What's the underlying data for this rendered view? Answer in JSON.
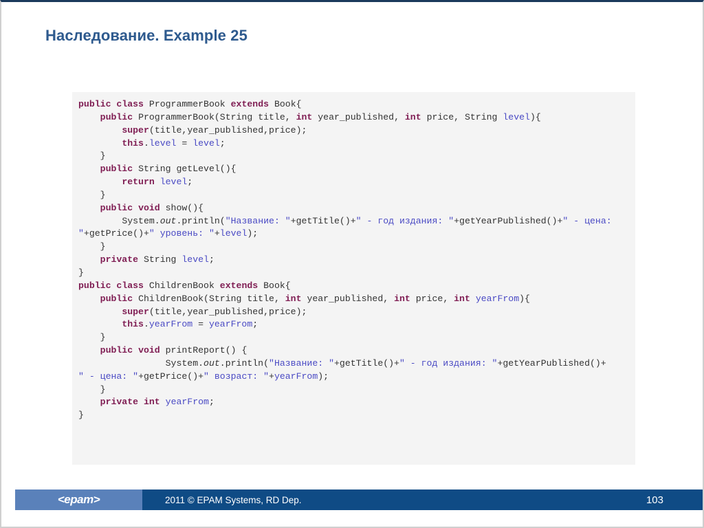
{
  "slide": {
    "title": "Наследование. Example 25",
    "accent_color": "#2e5a8e",
    "code_bg_color": "#f4f4f4",
    "keyword_color": "#7f1d53",
    "field_color": "#4a4ac4",
    "footer_bar_color": "#0f4b85",
    "footer_logo_bg_color": "#5a81ba"
  },
  "code": {
    "language": "java",
    "text": "public class ProgrammerBook extends Book{\n    public ProgrammerBook(String title, int year_published, int price, String level){\n        super(title,year_published,price);\n        this.level = level;\n    }\n    public String getLevel(){\n        return level;\n    }\n    public void show(){\n        System.out.println(\"Название: \"+getTitle()+\" - год издания: \"+getYearPublished()+\" - цена: \"+getPrice()+\" уровень: \"+level);\n    }\n    private String level;\n}\npublic class ChildrenBook extends Book{\n    public ChildrenBook(String title, int year_published, int price, int yearFrom){\n        super(title,year_published,price);\n        this.yearFrom = yearFrom;\n    }\n    public void printReport() {\n                System.out.println(\"Название: \"+getTitle()+\" - год издания: \"+getYearPublished()+\n\" - цена: \"+getPrice()+\" возраст: \"+yearFrom);\n    }\n    private int yearFrom;\n}",
    "lines": [
      "public class ProgrammerBook extends Book{",
      "    public ProgrammerBook(String title, int year_published, int price, String level){",
      "        super(title,year_published,price);",
      "        this.level = level;",
      "    }",
      "    public String getLevel(){",
      "        return level;",
      "    }",
      "    public void show(){",
      "        System.out.println(\"Название: \"+getTitle()+\" - год издания: \"+getYearPublished()+\" - цена: \"+getPrice()+\" уровень: \"+level);",
      "    }",
      "    private String level;",
      "}",
      "public class ChildrenBook extends Book{",
      "    public ChildrenBook(String title, int year_published, int price, int yearFrom){",
      "        super(title,year_published,price);",
      "        this.yearFrom = yearFrom;",
      "    }",
      "    public void printReport() {",
      "                System.out.println(\"Название: \"+getTitle()+\" - год издания: \"+getYearPublished()+",
      "\" - цена: \"+getPrice()+\" возраст: \"+yearFrom);",
      "    }",
      "    private int yearFrom;",
      "}"
    ]
  },
  "footer": {
    "logo": "<epam>",
    "copyright": "2011 © EPAM Systems, RD Dep.",
    "page_number": "103"
  }
}
